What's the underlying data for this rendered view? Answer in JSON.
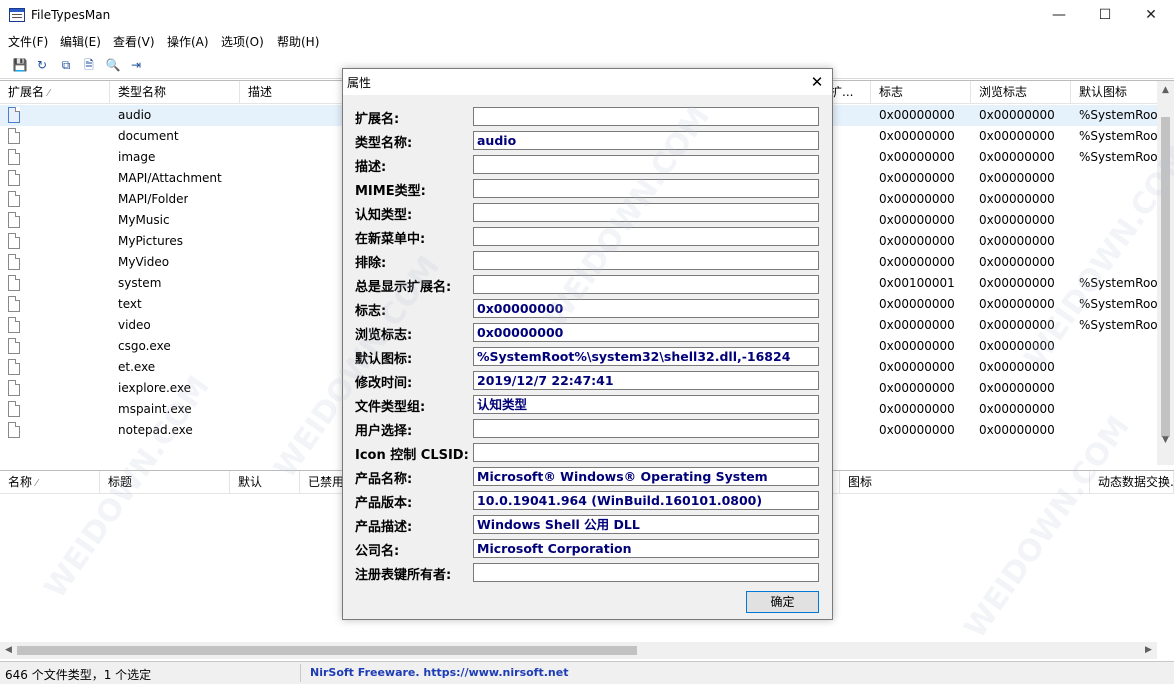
{
  "window": {
    "title": "FileTypesMan",
    "minimize": "—",
    "maximize": "☐",
    "close": "✕"
  },
  "menu": [
    "文件(F)",
    "编辑(E)",
    "查看(V)",
    "操作(A)",
    "选项(O)",
    "帮助(H)"
  ],
  "toolbar": [
    {
      "name": "save-icon",
      "glyph": "💾"
    },
    {
      "name": "refresh-icon",
      "glyph": "↻"
    },
    {
      "name": "copy-icon",
      "glyph": "⧉"
    },
    {
      "name": "properties-icon",
      "glyph": "🗎"
    },
    {
      "name": "find-icon",
      "glyph": "🔍"
    },
    {
      "name": "exit-icon",
      "glyph": "⇥"
    }
  ],
  "top_list": {
    "headers": [
      "扩展名",
      "类型名称",
      "描述",
      "渐扩...",
      "标志",
      "浏览标志",
      "默认图标"
    ],
    "rows": [
      {
        "name": "audio",
        "flag": "0x00000000",
        "bflag": "0x00000000",
        "icon": "%SystemRoot",
        "sel": true
      },
      {
        "name": "document",
        "flag": "0x00000000",
        "bflag": "0x00000000",
        "icon": "%SystemRoot"
      },
      {
        "name": "image",
        "flag": "0x00000000",
        "bflag": "0x00000000",
        "icon": "%SystemRoot"
      },
      {
        "name": "MAPI/Attachment",
        "flag": "0x00000000",
        "bflag": "0x00000000",
        "icon": ""
      },
      {
        "name": "MAPI/Folder",
        "flag": "0x00000000",
        "bflag": "0x00000000",
        "icon": ""
      },
      {
        "name": "MyMusic",
        "flag": "0x00000000",
        "bflag": "0x00000000",
        "icon": ""
      },
      {
        "name": "MyPictures",
        "flag": "0x00000000",
        "bflag": "0x00000000",
        "icon": ""
      },
      {
        "name": "MyVideo",
        "flag": "0x00000000",
        "bflag": "0x00000000",
        "icon": ""
      },
      {
        "name": "system",
        "flag": "0x00100001",
        "bflag": "0x00000000",
        "icon": "%SystemRoot"
      },
      {
        "name": "text",
        "flag": "0x00000000",
        "bflag": "0x00000000",
        "icon": "%SystemRoot"
      },
      {
        "name": "video",
        "flag": "0x00000000",
        "bflag": "0x00000000",
        "icon": "%SystemRoot"
      },
      {
        "name": "csgo.exe",
        "flag": "0x00000000",
        "bflag": "0x00000000",
        "icon": ""
      },
      {
        "name": "et.exe",
        "flag": "0x00000000",
        "bflag": "0x00000000",
        "icon": ""
      },
      {
        "name": "iexplore.exe",
        "flag": "0x00000000",
        "bflag": "0x00000000",
        "icon": ""
      },
      {
        "name": "mspaint.exe",
        "flag": "0x00000000",
        "bflag": "0x00000000",
        "icon": ""
      },
      {
        "name": "notepad.exe",
        "flag": "0x00000000",
        "bflag": "0x00000000",
        "icon": ""
      }
    ]
  },
  "bottom_list": {
    "headers": [
      "名称",
      "标题",
      "默认",
      "已禁用",
      "图标",
      "动态数据交换..."
    ]
  },
  "status": {
    "left": "646 个文件类型，1 个选定",
    "right": "NirSoft Freeware. https://www.nirsoft.net"
  },
  "dialog": {
    "title": "属性",
    "close": "✕",
    "ok": "确定",
    "fields": [
      {
        "label": "扩展名:",
        "value": ""
      },
      {
        "label": "类型名称:",
        "value": "audio"
      },
      {
        "label": "描述:",
        "value": ""
      },
      {
        "label": "MIME类型:",
        "value": ""
      },
      {
        "label": "认知类型:",
        "value": ""
      },
      {
        "label": "在新菜单中:",
        "value": ""
      },
      {
        "label": "排除:",
        "value": ""
      },
      {
        "label": "总是显示扩展名:",
        "value": ""
      },
      {
        "label": "标志:",
        "value": "0x00000000"
      },
      {
        "label": "浏览标志:",
        "value": "0x00000000"
      },
      {
        "label": "默认图标:",
        "value": "%SystemRoot%\\system32\\shell32.dll,-16824"
      },
      {
        "label": "修改时间:",
        "value": "2019/12/7 22:47:41"
      },
      {
        "label": "文件类型组:",
        "value": "认知类型"
      },
      {
        "label": "用户选择:",
        "value": ""
      },
      {
        "label": "Icon 控制 CLSID:",
        "value": ""
      },
      {
        "label": "产品名称:",
        "value": "Microsoft® Windows® Operating System"
      },
      {
        "label": "产品版本:",
        "value": "10.0.19041.964 (WinBuild.160101.0800)"
      },
      {
        "label": "产品描述:",
        "value": "Windows Shell 公用 DLL"
      },
      {
        "label": "公司名:",
        "value": "Microsoft Corporation"
      },
      {
        "label": "注册表键所有者:",
        "value": ""
      }
    ]
  },
  "watermark": "WEIDOWN.COM"
}
